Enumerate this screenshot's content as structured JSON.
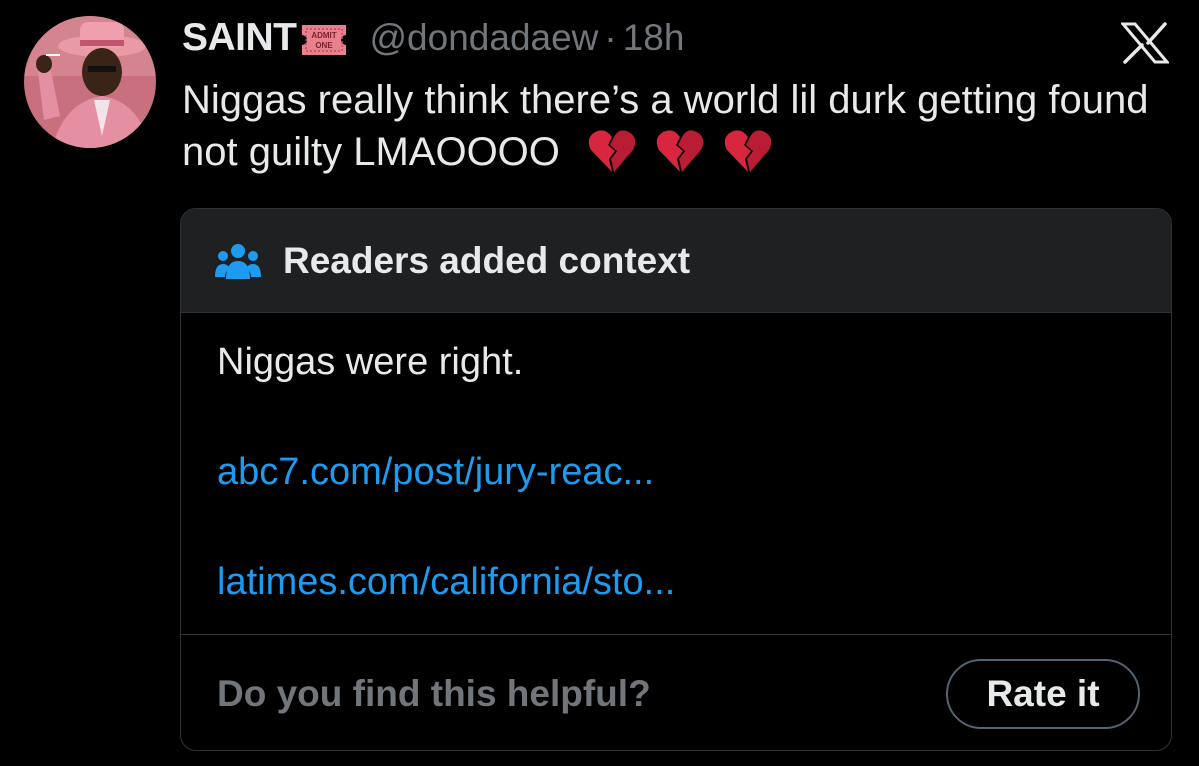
{
  "tweet": {
    "display_name": "SAINT",
    "badge_text_line1": "ADMIT",
    "badge_text_line2": "ONE",
    "handle": "@dondadaew",
    "separator": "·",
    "time": "18h",
    "text": "Niggas really think there’s a world lil durk getting found not guilty LMAOOOO",
    "emojis": [
      "broken-heart",
      "broken-heart",
      "broken-heart"
    ]
  },
  "platform_logo": "x-logo",
  "community_note": {
    "icon": "people-icon",
    "title": "Readers added context",
    "body": "Niggas were right.",
    "links": [
      "abc7.com/post/jury-reac...",
      "latimes.com/california/sto..."
    ],
    "helpful_prompt": "Do you find this helpful?",
    "rate_button_label": "Rate it"
  },
  "colors": {
    "background": "#000000",
    "text_primary": "#e7e9ea",
    "text_secondary": "#71767b",
    "link": "#1d9bf0",
    "note_header_bg": "#1e2022",
    "border": "#2f3336",
    "accent_icon": "#1d9bf0",
    "broken_heart": "#d7263d"
  }
}
